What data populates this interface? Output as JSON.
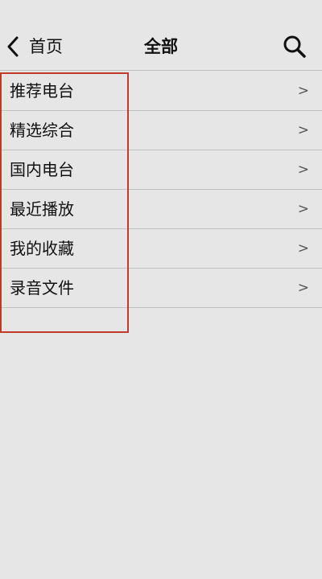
{
  "header": {
    "back_label": "首页",
    "title": "全部",
    "back_icon": "chevron-left-icon",
    "search_icon": "search-icon"
  },
  "list": {
    "items": [
      {
        "label": "推荐电台",
        "arrow": ">"
      },
      {
        "label": "精选综合",
        "arrow": ">"
      },
      {
        "label": "国内电台",
        "arrow": ">"
      },
      {
        "label": "最近播放",
        "arrow": ">"
      },
      {
        "label": "我的收藏",
        "arrow": ">"
      },
      {
        "label": "录音文件",
        "arrow": ">"
      }
    ]
  },
  "colors": {
    "background": "#e6e6e6",
    "divider": "#c2c2c2",
    "highlight": "#c0392b",
    "text": "#111111"
  }
}
